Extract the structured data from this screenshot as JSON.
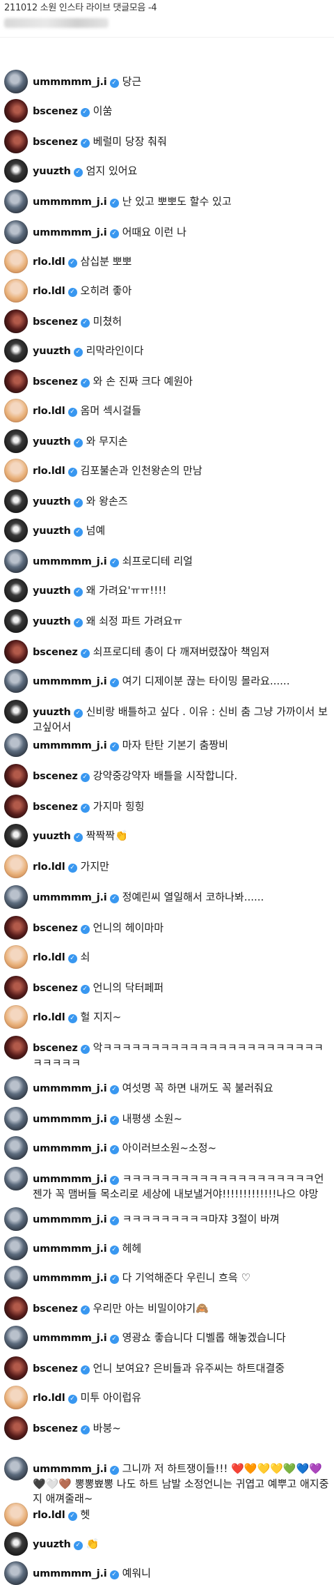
{
  "header": {
    "title": "211012 소원 인스타 라이브 댓글모음 -4"
  },
  "comments": [
    {
      "user": "ummmmm_j.i",
      "av": "ummmmm",
      "text": "당근"
    },
    {
      "user": "bscenez",
      "av": "bscenez",
      "text": "이쑴"
    },
    {
      "user": "bscenez",
      "av": "bscenez",
      "text": "베럴미 당장 춰줘"
    },
    {
      "user": "yuuzth",
      "av": "yuuzth",
      "text": "엄지 있어요"
    },
    {
      "user": "ummmmm_j.i",
      "av": "ummmmm",
      "text": "난 있고 뽀뽀도 할수 있고"
    },
    {
      "user": "ummmmm_j.i",
      "av": "ummmmm",
      "text": "어때요 이런 나"
    },
    {
      "user": "rlo.ldl",
      "av": "rlo",
      "text": "삼십분 뽀뽀"
    },
    {
      "user": "rlo.ldl",
      "av": "rlo",
      "text": "오히려 좋아"
    },
    {
      "user": "bscenez",
      "av": "bscenez",
      "text": "미쳤허"
    },
    {
      "user": "yuuzth",
      "av": "yuuzth",
      "text": "리막라인이다"
    },
    {
      "user": "bscenez",
      "av": "bscenez",
      "text": "와 손 진짜 크다 예원아"
    },
    {
      "user": "rlo.ldl",
      "av": "rlo",
      "text": "옴머 섹시걸들"
    },
    {
      "user": "yuuzth",
      "av": "yuuzth",
      "text": "와 무지손"
    },
    {
      "user": "rlo.ldl",
      "av": "rlo",
      "text": "김포불손과 인천왕손의 만남"
    },
    {
      "user": "yuuzth",
      "av": "yuuzth",
      "text": "와 왕손즈"
    },
    {
      "user": "yuuzth",
      "av": "yuuzth",
      "text": "넘예"
    },
    {
      "user": "ummmmm_j.i",
      "av": "ummmmm",
      "text": "쇠프로디테 리얼"
    },
    {
      "user": "yuuzth",
      "av": "yuuzth",
      "text": "왜 가려요'ㅠㅠ!!!!"
    },
    {
      "user": "yuuzth",
      "av": "yuuzth",
      "text": "왜 쇠정 파트 가려요ㅠ"
    },
    {
      "user": "bscenez",
      "av": "bscenez",
      "text": "쇠프로디테 총이 다 깨져버렸잖아 책임져"
    },
    {
      "user": "ummmmm_j.i",
      "av": "ummmmm",
      "text": "여기 디제이분 끊는 타이밍 몰라요......"
    },
    {
      "user": "yuuzth",
      "av": "yuuzth",
      "text": "신비랑 배틀하고 싶다 . 이유 : 신비 춤 그냥 가까이서 보고싶어서"
    },
    {
      "user": "ummmmm_j.i",
      "av": "ummmmm",
      "text": "마자 탄탄 기본기 춤짱비"
    },
    {
      "user": "bscenez",
      "av": "bscenez",
      "text": "강약중강약자 배틀을 시작합니다."
    },
    {
      "user": "bscenez",
      "av": "bscenez",
      "text": "가지마 힝힝"
    },
    {
      "user": "yuuzth",
      "av": "yuuzth",
      "text": "짝짝짝👏"
    },
    {
      "user": "rlo.ldl",
      "av": "rlo",
      "text": "가지만"
    },
    {
      "user": "ummmmm_j.i",
      "av": "ummmmm",
      "text": "정예린씨 열일해서 코하나봐......"
    },
    {
      "user": "bscenez",
      "av": "bscenez",
      "text": "언니의 헤이마마"
    },
    {
      "user": "rlo.ldl",
      "av": "rlo",
      "text": "쇠"
    },
    {
      "user": "bscenez",
      "av": "bscenez",
      "text": "언니의 닥터페퍼"
    },
    {
      "user": "rlo.ldl",
      "av": "rlo",
      "text": "헐 지지~"
    },
    {
      "user": "bscenez",
      "av": "bscenez",
      "text": "악ㅋㅋㅋㅋㅋㅋㅋㅋㅋㅋㅋㅋㅋㅋㅋㅋㅋㅋㅋㅋㅋㅋㅋㅋㅋㅋㅋㅋ"
    },
    {
      "user": "ummmmm_j.i",
      "av": "ummmmm",
      "text": "여섯명 꼭 하면 내꺼도 꼭 불러줘요"
    },
    {
      "user": "ummmmm_j.i",
      "av": "ummmmm",
      "text": "내평생 소원~"
    },
    {
      "user": "ummmmm_j.i",
      "av": "ummmmm",
      "text": "아이러브소원~소정~"
    },
    {
      "user": "ummmmm_j.i",
      "av": "ummmmm",
      "text": "ㅋㅋㅋㅋㅋㅋㅋㅋㅋㅋㅋㅋㅋㅋㅋㅋㅋㅋㅋㅋ언젠가 꼭 맴버들 목소리로 세상에 내보낼거야!!!!!!!!!!!!!나으 야망"
    },
    {
      "user": "ummmmm_j.i",
      "av": "ummmmm",
      "text": "ㅋㅋㅋㅋㅋㅋㅋㅋㅋ마쟈 3절이 바껴"
    },
    {
      "user": "ummmmm_j.i",
      "av": "ummmmm",
      "text": "헤헤"
    },
    {
      "user": "ummmmm_j.i",
      "av": "ummmmm",
      "text": "다 기억해준다 우린니 흐윽 ♡"
    },
    {
      "user": "bscenez",
      "av": "bscenez",
      "text": "우리만 아는 비밀이야기🙈"
    },
    {
      "user": "ummmmm_j.i",
      "av": "ummmmm",
      "text": "영광쇼 좋습니다 디벨롭 해놓겠습니다"
    },
    {
      "user": "bscenez",
      "av": "bscenez",
      "text": "언니 보여요? 은비들과 유주씨는 하트대결중"
    },
    {
      "user": "rlo.ldl",
      "av": "rlo",
      "text": "미투 아이럽유"
    },
    {
      "user": "bscenez",
      "av": "bscenez",
      "text": "바붕~"
    },
    {
      "user": "ummmmm_j.i",
      "av": "ummmmm",
      "text": "그니까 저 하트쟁이들!!! ❤️🧡💛💛💚💙💜🖤🤍🤎 뽕뽕뾰뽕 나도 하트 남발 소정언니는 귀엽고 예뿌고 애지중지 애껴줄래~"
    },
    {
      "user": "rlo.ldl",
      "av": "rlo",
      "text": "헷"
    },
    {
      "user": "yuuzth",
      "av": "yuuzth",
      "text": "👏"
    },
    {
      "user": "ummmmm_j.i",
      "av": "ummmmm",
      "text": "예워니"
    }
  ]
}
